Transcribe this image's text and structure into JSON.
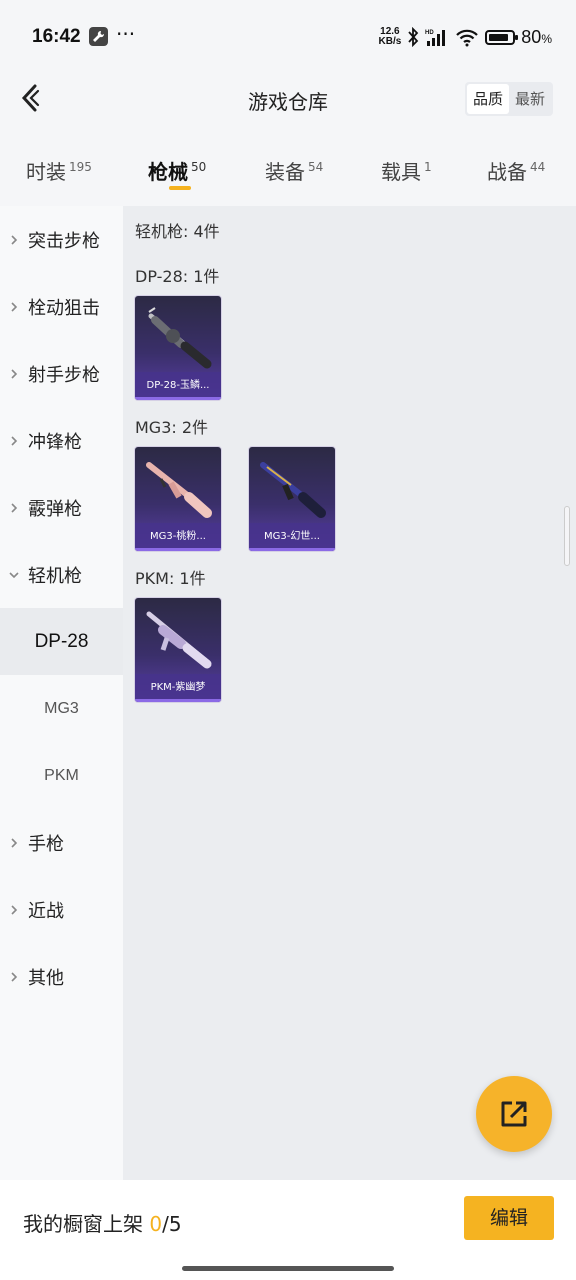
{
  "status_bar": {
    "time": "16:42",
    "dots": "···",
    "speed_top": "12.6",
    "speed_bottom": "KB/s",
    "battery_pct": "80",
    "battery_unit": "%"
  },
  "header": {
    "title": "游戏仓库",
    "sort_options": [
      "品质",
      "最新"
    ],
    "active_sort": "品质"
  },
  "tabs": [
    {
      "label": "时装",
      "count": "195"
    },
    {
      "label": "枪械",
      "count": "50"
    },
    {
      "label": "装备",
      "count": "54"
    },
    {
      "label": "载具",
      "count": "1"
    },
    {
      "label": "战备",
      "count": "44"
    }
  ],
  "active_tab": "枪械",
  "sidebar": {
    "items": [
      {
        "label": "突击步枪",
        "type": "category"
      },
      {
        "label": "栓动狙击",
        "type": "category"
      },
      {
        "label": "射手步枪",
        "type": "category"
      },
      {
        "label": "冲锋枪",
        "type": "category"
      },
      {
        "label": "霰弹枪",
        "type": "category"
      },
      {
        "label": "轻机枪",
        "type": "category-expanded"
      },
      {
        "label": "DP-28",
        "type": "sub"
      },
      {
        "label": "MG3",
        "type": "sub"
      },
      {
        "label": "PKM",
        "type": "sub"
      },
      {
        "label": "手枪",
        "type": "category"
      },
      {
        "label": "近战",
        "type": "category"
      },
      {
        "label": "其他",
        "type": "category"
      }
    ],
    "active_item": "DP-28"
  },
  "content": {
    "summary": "轻机枪: 4件",
    "groups": [
      {
        "label": "DP-28: 1件",
        "items": [
          {
            "name": "DP-28-玉鳞..."
          }
        ]
      },
      {
        "label": "MG3: 2件",
        "items": [
          {
            "name": "MG3-桃粉..."
          },
          {
            "name": "MG3-幻世..."
          }
        ]
      },
      {
        "label": "PKM: 1件",
        "items": [
          {
            "name": "PKM-紫幽梦"
          }
        ]
      }
    ]
  },
  "bottom_bar": {
    "shelf_label": "我的橱窗上架 ",
    "shelf_count": "0",
    "shelf_total": "/5",
    "edit_label": "编辑"
  },
  "colors": {
    "accent": "#f5b21f",
    "card_bg_top": "#2c2a44",
    "card_bg_bottom": "#5a3fa6"
  },
  "icons": {
    "back": "chevron-left-icon",
    "fab": "share-external-icon",
    "status_tool": "wrench-icon"
  }
}
